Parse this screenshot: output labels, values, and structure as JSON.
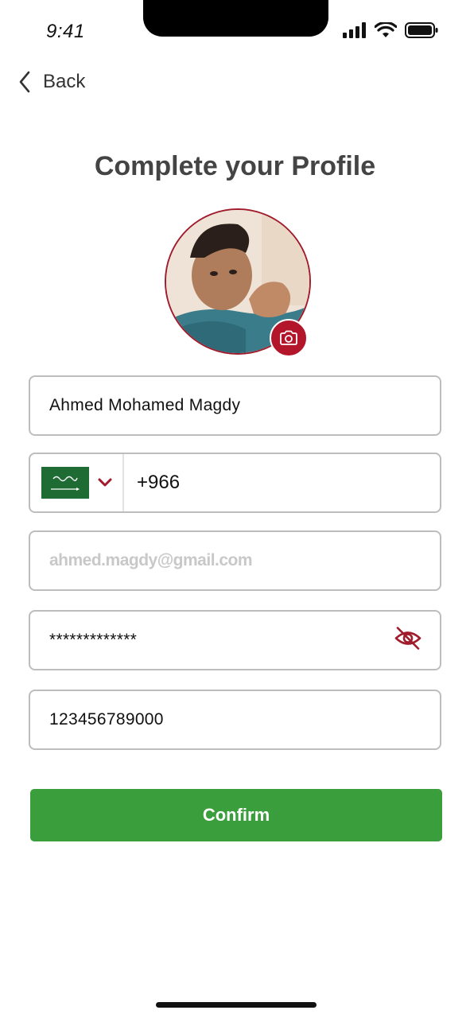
{
  "status_bar": {
    "time": "9:41"
  },
  "header": {
    "back_label": "Back",
    "title": "Complete your Profile"
  },
  "profile": {
    "name": "Ahmed Mohamed Magdy"
  },
  "phone": {
    "country_code": "+966"
  },
  "email": {
    "value": "ahmed.magdy@gmail.com"
  },
  "password": {
    "value": "*************"
  },
  "id_number": {
    "value": "123456789000"
  },
  "actions": {
    "confirm_label": "Confirm"
  },
  "colors": {
    "accent": "#b3162a",
    "primary_button": "#3a9e3d",
    "border": "#bdbdbd",
    "flag_green": "#1f6b34"
  },
  "icons": {
    "back": "chevron-left-icon",
    "camera": "camera-icon",
    "dropdown": "chevron-down-icon",
    "visibility": "eye-off-icon"
  }
}
